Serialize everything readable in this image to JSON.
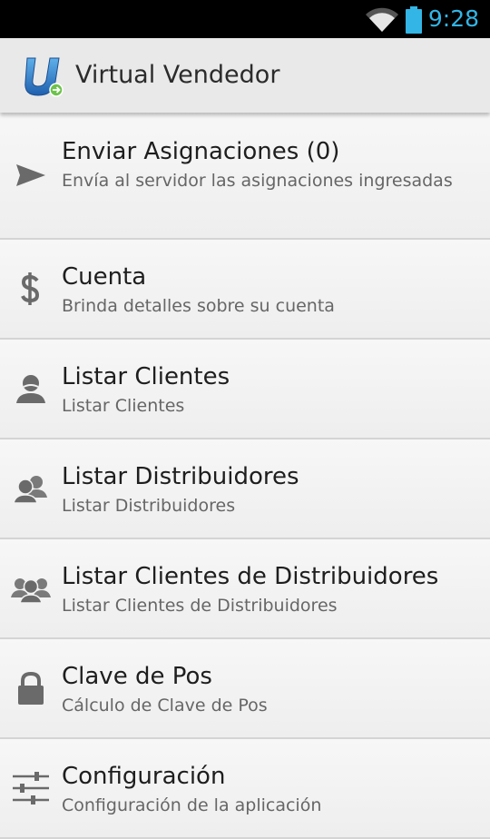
{
  "status_bar": {
    "time": "9:28",
    "time_color": "#33b5e5"
  },
  "action_bar": {
    "title": "Virtual Vendedor",
    "logo": "virtual-vendedor-logo"
  },
  "menu": [
    {
      "title": "Enviar Asignaciones (0)",
      "subtitle": "Envía al servidor las asignaciones ingresadas",
      "icon": "send-icon"
    },
    {
      "title": "Cuenta",
      "subtitle": "Brinda detalles sobre su cuenta",
      "icon": "dollar-icon"
    },
    {
      "title": "Listar Clientes",
      "subtitle": "Listar Clientes",
      "icon": "person-icon"
    },
    {
      "title": "Listar Distribuidores",
      "subtitle": "Listar Distribuidores",
      "icon": "two-persons-icon"
    },
    {
      "title": "Listar Clientes de Distribuidores",
      "subtitle": "Listar Clientes de Distribuidores",
      "icon": "group-icon"
    },
    {
      "title": "Clave de Pos",
      "subtitle": "Cálculo de Clave de Pos",
      "icon": "lock-icon"
    },
    {
      "title": "Configuración",
      "subtitle": "Configuración de la aplicación",
      "icon": "sliders-icon"
    }
  ]
}
